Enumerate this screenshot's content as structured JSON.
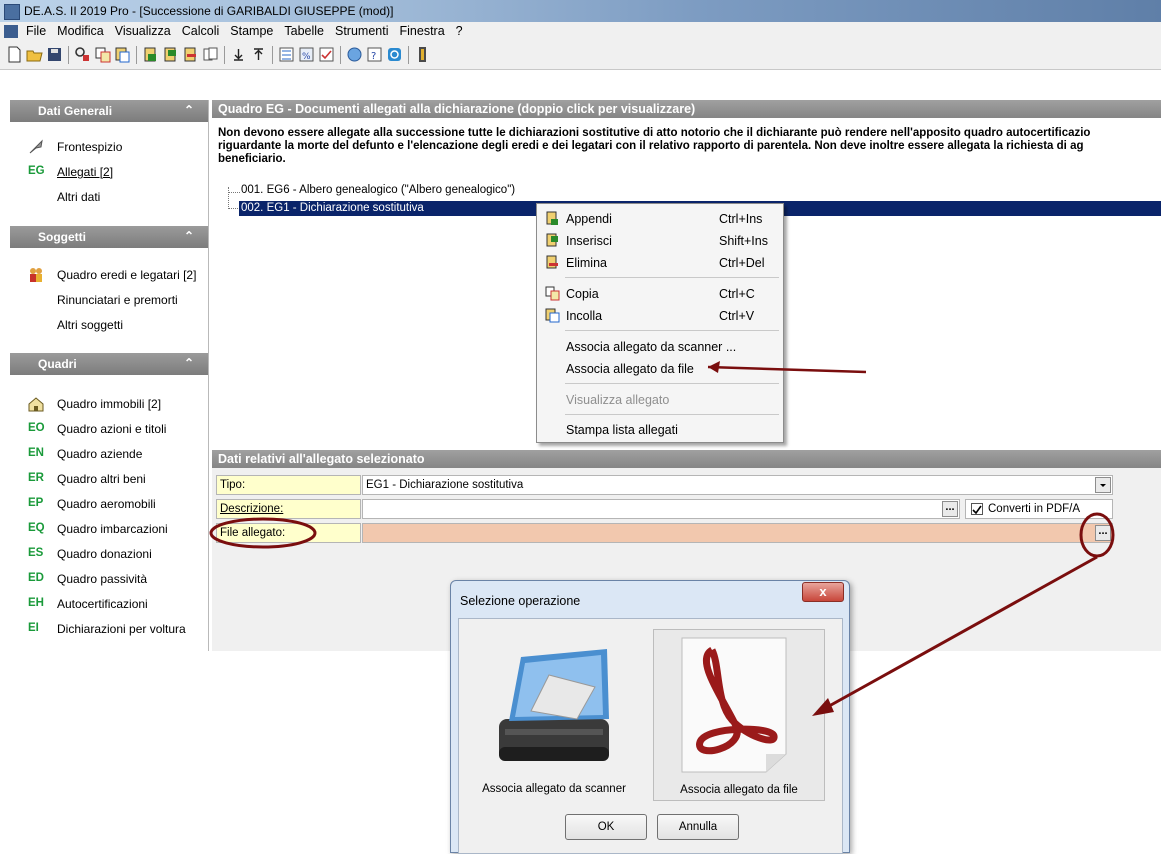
{
  "window": {
    "title": "DE.A.S. II 2019 Pro - [Successione di GARIBALDI GIUSEPPE (mod)]"
  },
  "menu": [
    "File",
    "Modifica",
    "Visualizza",
    "Calcoli",
    "Stampe",
    "Tabelle",
    "Strumenti",
    "Finestra",
    "?"
  ],
  "sidebar": {
    "general": {
      "title": "Dati Generali",
      "items": [
        {
          "icon": "quill-icon",
          "code": "",
          "label": "Frontespizio"
        },
        {
          "icon": "",
          "code": "EG",
          "label": "Allegati [2]"
        },
        {
          "icon": "",
          "code": "",
          "label": "Altri dati"
        }
      ]
    },
    "subjects": {
      "title": "Soggetti",
      "items": [
        {
          "icon": "people-icon",
          "code": "",
          "label": "Quadro eredi e legatari [2]"
        },
        {
          "icon": "",
          "code": "",
          "label": "Rinunciatari e premorti"
        },
        {
          "icon": "",
          "code": "",
          "label": "Altri soggetti"
        }
      ]
    },
    "frames": {
      "title": "Quadri",
      "items": [
        {
          "icon": "house-icon",
          "code": "",
          "label": "Quadro immobili [2]"
        },
        {
          "icon": "",
          "code": "EO",
          "label": "Quadro azioni e titoli"
        },
        {
          "icon": "",
          "code": "EN",
          "label": "Quadro aziende"
        },
        {
          "icon": "",
          "code": "ER",
          "label": "Quadro altri beni"
        },
        {
          "icon": "",
          "code": "EP",
          "label": "Quadro aeromobili"
        },
        {
          "icon": "",
          "code": "EQ",
          "label": "Quadro imbarcazioni"
        },
        {
          "icon": "",
          "code": "ES",
          "label": "Quadro donazioni"
        },
        {
          "icon": "",
          "code": "ED",
          "label": "Quadro passività"
        },
        {
          "icon": "",
          "code": "EH",
          "label": "Autocertificazioni"
        },
        {
          "icon": "",
          "code": "EI",
          "label": "Dichiarazioni per voltura"
        }
      ]
    }
  },
  "quadro": {
    "header": "Quadro EG - Documenti allegati alla dichiarazione (doppio click per visualizzare)",
    "info": [
      "Non devono essere allegate alla successione tutte le dichiarazioni sostitutive di atto notorio che il dichiarante può rendere nell'apposito quadro autocertificazio",
      "riguardante la morte del defunto e l'elencazione degli eredi e dei legatari con il relativo rapporto di parentela. Non deve inoltre essere allegata la richiesta di ag",
      "beneficiario."
    ],
    "tree": [
      {
        "label": "001. EG6 - Albero genealogico (\"Albero genealogico\")",
        "selected": false
      },
      {
        "label": "002. EG1 - Dichiarazione sostitutiva",
        "selected": true
      }
    ]
  },
  "context_menu": [
    {
      "icon": "append-icon",
      "label": "Appendi",
      "shortcut": "Ctrl+Ins",
      "disabled": false
    },
    {
      "icon": "insert-icon",
      "label": "Inserisci",
      "shortcut": "Shift+Ins",
      "disabled": false
    },
    {
      "icon": "delete-icon",
      "label": "Elimina",
      "shortcut": "Ctrl+Del",
      "disabled": false
    },
    {
      "icon": "copy-icon",
      "label": "Copia",
      "shortcut": "Ctrl+C",
      "disabled": false
    },
    {
      "icon": "paste-icon",
      "label": "Incolla",
      "shortcut": "Ctrl+V",
      "disabled": false
    },
    {
      "icon": "",
      "label": "Associa allegato da scanner ...",
      "shortcut": "",
      "disabled": false
    },
    {
      "icon": "",
      "label": "Associa allegato da file",
      "shortcut": "",
      "disabled": false
    },
    {
      "icon": "",
      "label": "Visualizza allegato",
      "shortcut": "",
      "disabled": true
    },
    {
      "icon": "",
      "label": "Stampa lista allegati",
      "shortcut": "",
      "disabled": false
    }
  ],
  "details": {
    "header": "Dati relativi all'allegato selezionato",
    "tipo_label": "Tipo:",
    "tipo_value": "EG1 - Dichiarazione sostitutiva",
    "descrizione_label": "Descrizione:",
    "descrizione_value": "",
    "converti_label": "Converti in PDF/A",
    "converti_checked": true,
    "file_label": "File allegato:",
    "file_value": "",
    "ellipsis": "..."
  },
  "dialog": {
    "title": "Selezione operazione",
    "close": "x",
    "option_scanner": "Associa allegato da scanner",
    "option_file": "Associa allegato da file",
    "ok": "OK",
    "cancel": "Annulla"
  },
  "colors": {
    "selection": "#0a246a",
    "file_field": "#f2c8ae",
    "label_bg": "#ffffcc",
    "code_green": "#1a9a3a",
    "annotation": "#7a0e0e"
  }
}
